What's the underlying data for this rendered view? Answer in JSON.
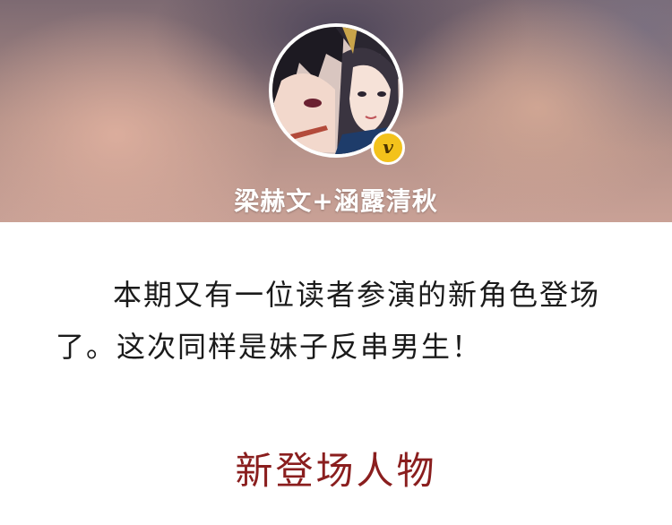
{
  "header": {
    "author_name": "梁赫文+涵露清秋",
    "badge_letter": "v"
  },
  "article": {
    "intro_text": "本期又有一位读者参演的新角色登场了。这次同样是妹子反串男生！",
    "section_title": "新登场人物"
  }
}
